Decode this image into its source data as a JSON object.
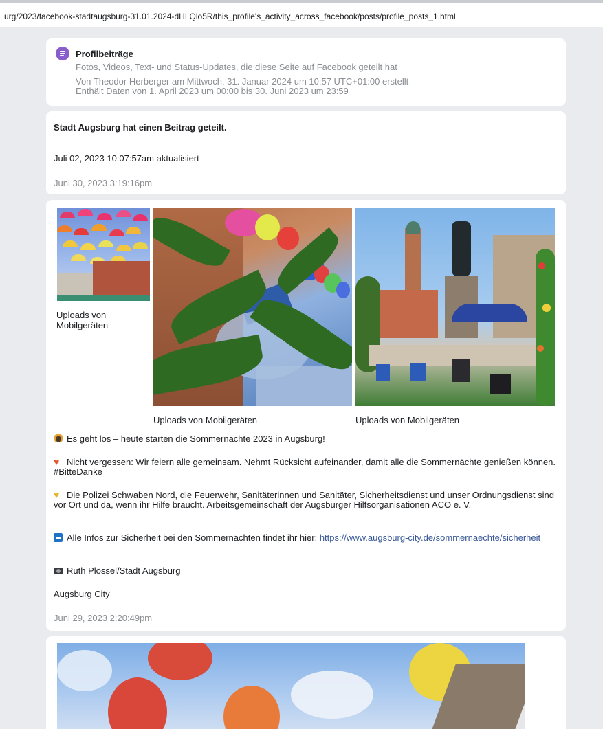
{
  "browser": {
    "url": "urg/2023/facebook-stadtaugsburg-31.01.2024-dHLQlo5R/this_profile's_activity_across_facebook/posts/profile_posts_1.html"
  },
  "header": {
    "icon": "document-icon",
    "title": "Profilbeiträge",
    "subtitle": "Fotos, Videos, Text- und Status-Updates, die diese Seite auf Facebook geteilt hat",
    "created": "Von Theodor Herberger am Mittwoch, 31. Januar 2024 um 10:57 UTC+01:00 erstellt",
    "range": "Enthält Daten von 1. April 2023 um 00:00 bis 30. Juni 2023 um 23:59"
  },
  "post1": {
    "title": "Stadt Augsburg hat einen Beitrag geteilt.",
    "updated": "Juli 02, 2023 10:07:57am aktualisiert",
    "date": "Juni 30, 2023 3:19:16pm"
  },
  "post2": {
    "captions": [
      "Uploads von Mobilgeräten",
      "Uploads von Mobilgeräten",
      "Uploads von Mobilgeräten"
    ],
    "paragraphs": [
      {
        "icon": "people-icon",
        "text": "Es geht los – heute starten die Sommernächte 2023 in Augsburg!"
      },
      {
        "icon": "heart-icon",
        "text": "Nicht vergessen: Wir feiern alle gemeinsam. Nehmt Rücksicht aufeinander, damit alle die Sommernächte genießen können. #BitteDanke"
      },
      {
        "icon": "yellow-heart-icon",
        "text": "Die Polizei Schwaben Nord, die Feuerwehr, Sanitäterinnen und Sanitäter, Sicherheitsdienst und unser Ordnungsdienst sind vor Ort und da, wenn ihr Hilfe braucht. Arbeitsgemeinschaft der Augsburger Hilfsorganisationen ACO e. V."
      },
      {
        "icon": "minus-icon",
        "text": "Alle Infos zur Sicherheit bei den Sommernächten findet ihr hier: ",
        "link": "https://www.augsburg-city.de/sommernaechte/sicherheit"
      },
      {
        "icon": "camera-icon",
        "text": "Ruth Plössel/Stadt Augsburg"
      },
      {
        "icon": "",
        "text": "Augsburg City"
      }
    ],
    "date": "Juni 29, 2023 2:20:49pm"
  }
}
